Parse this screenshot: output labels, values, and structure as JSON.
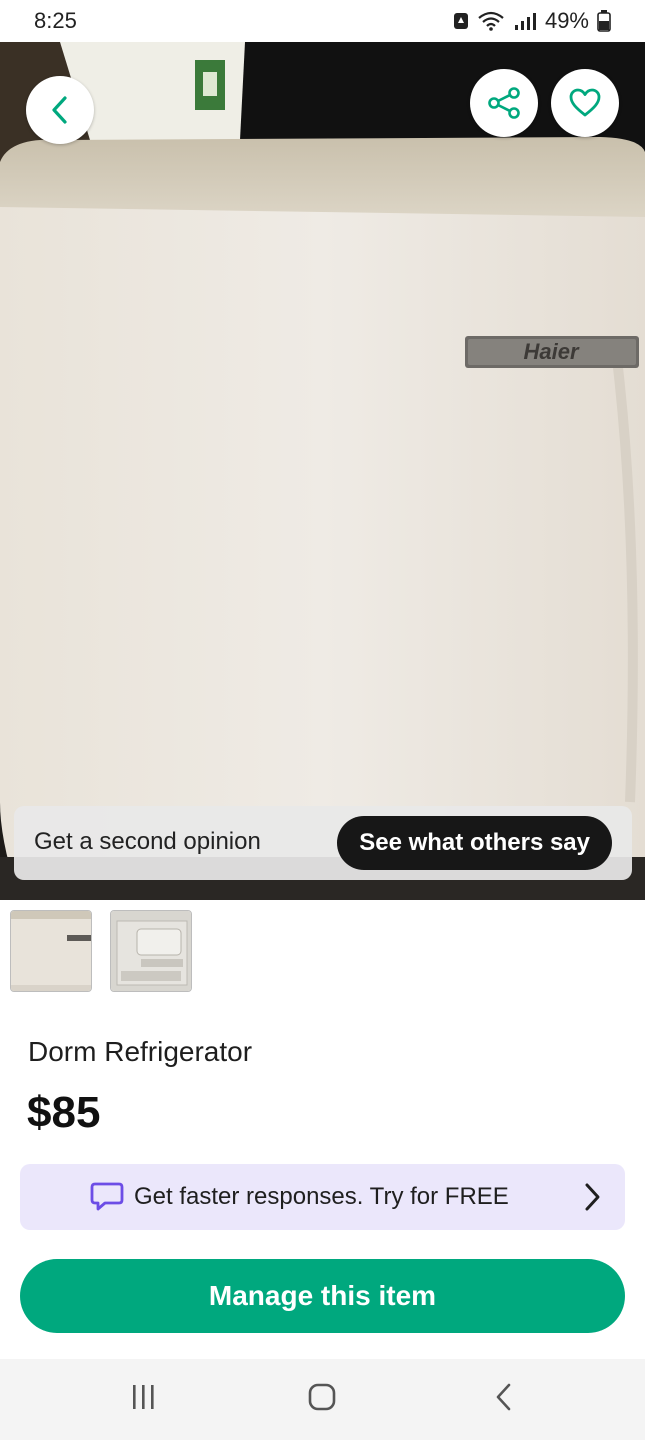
{
  "status_bar": {
    "time": "8:25",
    "battery": "49%"
  },
  "photo": {
    "brand_label": "Haier",
    "icons": [
      "chevron-left-icon",
      "share-icon",
      "heart-icon"
    ],
    "opinion": {
      "text": "Get a second opinion",
      "button": "See what others say"
    }
  },
  "thumbnails": [
    {
      "name": "fridge-front"
    },
    {
      "name": "fridge-interior"
    }
  ],
  "item": {
    "title": "Dorm Refrigerator",
    "price": "$85"
  },
  "promo": {
    "text": "Get faster responses. Try for FREE",
    "icon": "chat-bubble-icon",
    "accent": "#6c4de6"
  },
  "actions": {
    "manage_label": "Manage this item",
    "color": "#00a87e"
  },
  "nav": {
    "icons": [
      "recent-apps-icon",
      "home-icon",
      "back-icon"
    ]
  }
}
